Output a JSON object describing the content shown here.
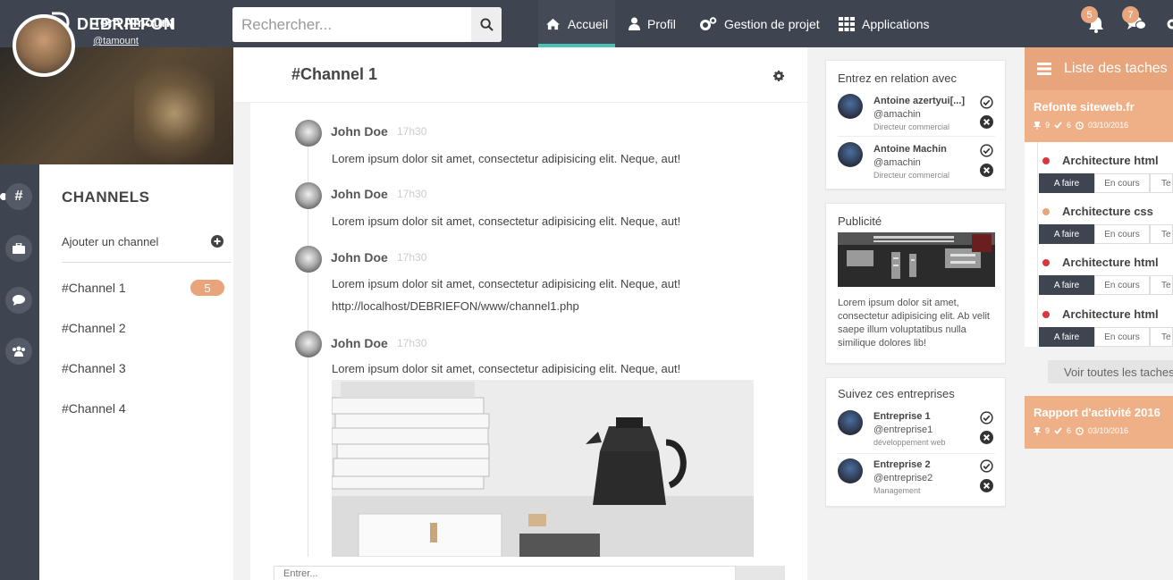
{
  "brand": {
    "name": "DEBRIEFON"
  },
  "search": {
    "placeholder": "Rechercher..."
  },
  "nav": {
    "items": [
      {
        "label": "Accueil"
      },
      {
        "label": "Profil"
      },
      {
        "label": "Gestion de projet"
      },
      {
        "label": "Applications"
      }
    ]
  },
  "notifications": {
    "bell_count": "5",
    "chat_count": "7"
  },
  "profile": {
    "name": "Tom Amount",
    "handle": "@tamount"
  },
  "channels": {
    "title": "CHANNELS",
    "add_label": "Ajouter un channel",
    "items": [
      {
        "label": "#Channel 1",
        "badge": "5"
      },
      {
        "label": "#Channel 2"
      },
      {
        "label": "#Channel 3"
      },
      {
        "label": "#Channel 4"
      }
    ]
  },
  "chat": {
    "title": "#Channel 1",
    "input_placeholder": "Entrer...",
    "messages": [
      {
        "author": "John Doe",
        "time": "17h30",
        "text": "Lorem ipsum dolor sit amet, consectetur adipisicing elit. Neque, aut!"
      },
      {
        "author": "John Doe",
        "time": "17h30",
        "text": "Lorem ipsum dolor sit amet, consectetur adipisicing elit. Neque, aut!"
      },
      {
        "author": "John Doe",
        "time": "17h30",
        "text": "Lorem ipsum dolor sit amet, consectetur adipisicing elit. Neque, aut!",
        "link": "http://localhost/DEBRIEFON/www/channel1.php"
      },
      {
        "author": "John Doe",
        "time": "17h30",
        "text": "Lorem ipsum dolor sit amet, consectetur adipisicing elit. Neque, aut!"
      }
    ]
  },
  "relations": {
    "title": "Entrez en relation avec",
    "people": [
      {
        "name": "Antoine azertyui[...]",
        "handle": "@amachin",
        "role": "Directeur commercial"
      },
      {
        "name": "Antoine Machin",
        "handle": "@amachin",
        "role": "Directeur commercial"
      }
    ]
  },
  "ad": {
    "title": "Publicité",
    "text": "Lorem ipsum dolor sit amet, consectetur adipisicing elit. Ab velit saepe illum voluptatibus nulla similique dolores lib!"
  },
  "companies": {
    "title": "Suivez ces entreprises",
    "items": [
      {
        "name": "Entreprise 1",
        "handle": "@entreprise1",
        "sector": "développement web"
      },
      {
        "name": "Entreprise 2",
        "handle": "@entreprise2",
        "sector": "Management"
      }
    ]
  },
  "tasks": {
    "title": "Liste des taches",
    "view_all": "Voir toutes les taches",
    "projects": [
      {
        "name": "Refonte siteweb.fr",
        "pins": "9",
        "checks": "6",
        "date": "03/10/2016"
      },
      {
        "name": "Rapport d'activité 2016",
        "pins": "9",
        "checks": "6",
        "date": "03/10/2016"
      }
    ],
    "items": [
      {
        "name": "Architecture html",
        "status_color": "#d9363e"
      },
      {
        "name": "Architecture css",
        "status_color": "#e8a47a"
      },
      {
        "name": "Architecture html",
        "status_color": "#d9363e"
      },
      {
        "name": "Architecture html",
        "status_color": "#d9363e"
      }
    ],
    "states": [
      "A faire",
      "En cours",
      "Te"
    ]
  },
  "colors": {
    "topbar": "#3e4450",
    "accent": "#e8a47a",
    "nav_active": "#4ec1b5"
  }
}
